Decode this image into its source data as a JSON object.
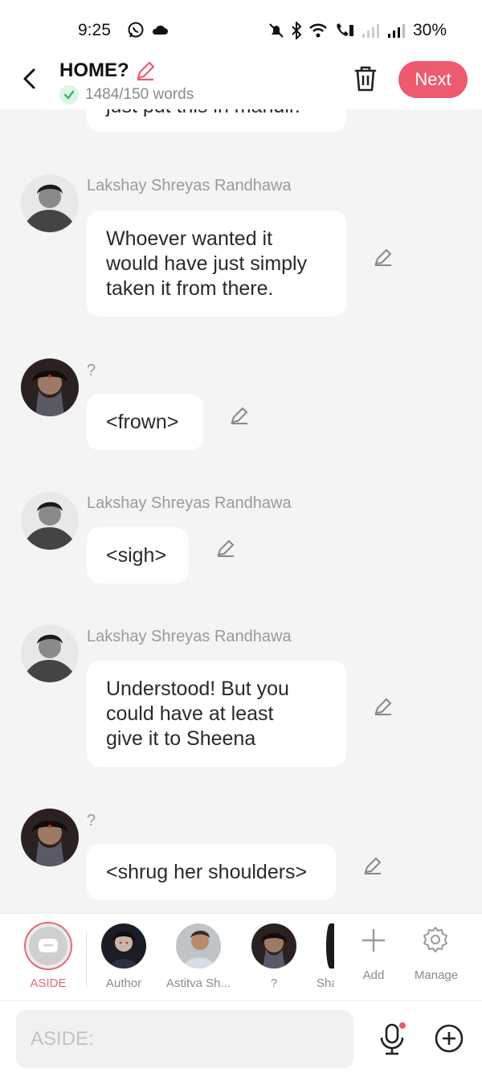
{
  "status_bar": {
    "time": "9:25",
    "battery": "30%"
  },
  "header": {
    "title": "HOME?",
    "word_count": "1484/150 words",
    "next_label": "Next",
    "accent": "#ee5a6f"
  },
  "chat": {
    "partial_text": "just put this in mandir.",
    "messages": [
      {
        "speaker": "Lakshay Shreyas Randhawa",
        "lines": [
          "Whoever wanted it",
          "would have just simply",
          "taken it from there."
        ]
      },
      {
        "speaker": "?",
        "lines": [
          "<frown>"
        ]
      },
      {
        "speaker": "Lakshay Shreyas Randhawa",
        "lines": [
          "<sigh>"
        ]
      },
      {
        "speaker": "Lakshay Shreyas Randhawa",
        "lines": [
          "Understood! But you",
          "could have at least",
          "give it to Sheena"
        ]
      },
      {
        "speaker": "?",
        "lines": [
          "<shrug her shoulders>"
        ]
      }
    ]
  },
  "characters": {
    "items": [
      "ASIDE",
      "Author",
      "Astitva Sh...",
      "?",
      "Sha"
    ],
    "add_label": "Add",
    "manage_label": "Manage"
  },
  "input": {
    "placeholder": "ASIDE:"
  }
}
